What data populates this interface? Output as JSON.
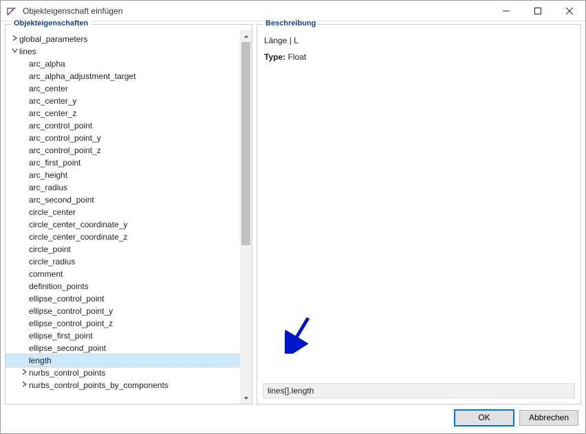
{
  "window": {
    "title": "Objekteigenschaft einfügen"
  },
  "left_panel": {
    "title": "Objekteigenschaften",
    "scroll": {
      "thumb_top_pct": 0,
      "thumb_height_pct": 58
    }
  },
  "right_panel": {
    "title": "Beschreibung",
    "desc_line": "Länge | L",
    "type_label": "Type:",
    "type_value": "Float",
    "path_value": "lines[].length"
  },
  "buttons": {
    "ok": "OK",
    "cancel": "Abbrechen"
  },
  "tree": [
    {
      "label": "global_parameters",
      "depth": 0,
      "expander": ">",
      "selected": false
    },
    {
      "label": "lines",
      "depth": 0,
      "expander": "v",
      "selected": false
    },
    {
      "label": "arc_alpha",
      "depth": 1,
      "expander": "",
      "selected": false
    },
    {
      "label": "arc_alpha_adjustment_target",
      "depth": 1,
      "expander": "",
      "selected": false
    },
    {
      "label": "arc_center",
      "depth": 1,
      "expander": "",
      "selected": false
    },
    {
      "label": "arc_center_y",
      "depth": 1,
      "expander": "",
      "selected": false
    },
    {
      "label": "arc_center_z",
      "depth": 1,
      "expander": "",
      "selected": false
    },
    {
      "label": "arc_control_point",
      "depth": 1,
      "expander": "",
      "selected": false
    },
    {
      "label": "arc_control_point_y",
      "depth": 1,
      "expander": "",
      "selected": false
    },
    {
      "label": "arc_control_point_z",
      "depth": 1,
      "expander": "",
      "selected": false
    },
    {
      "label": "arc_first_point",
      "depth": 1,
      "expander": "",
      "selected": false
    },
    {
      "label": "arc_height",
      "depth": 1,
      "expander": "",
      "selected": false
    },
    {
      "label": "arc_radius",
      "depth": 1,
      "expander": "",
      "selected": false
    },
    {
      "label": "arc_second_point",
      "depth": 1,
      "expander": "",
      "selected": false
    },
    {
      "label": "circle_center",
      "depth": 1,
      "expander": "",
      "selected": false
    },
    {
      "label": "circle_center_coordinate_y",
      "depth": 1,
      "expander": "",
      "selected": false
    },
    {
      "label": "circle_center_coordinate_z",
      "depth": 1,
      "expander": "",
      "selected": false
    },
    {
      "label": "circle_point",
      "depth": 1,
      "expander": "",
      "selected": false
    },
    {
      "label": "circle_radius",
      "depth": 1,
      "expander": "",
      "selected": false
    },
    {
      "label": "comment",
      "depth": 1,
      "expander": "",
      "selected": false
    },
    {
      "label": "definition_points",
      "depth": 1,
      "expander": "",
      "selected": false
    },
    {
      "label": "ellipse_control_point",
      "depth": 1,
      "expander": "",
      "selected": false
    },
    {
      "label": "ellipse_control_point_y",
      "depth": 1,
      "expander": "",
      "selected": false
    },
    {
      "label": "ellipse_control_point_z",
      "depth": 1,
      "expander": "",
      "selected": false
    },
    {
      "label": "ellipse_first_point",
      "depth": 1,
      "expander": "",
      "selected": false
    },
    {
      "label": "ellipse_second_point",
      "depth": 1,
      "expander": "",
      "selected": false
    },
    {
      "label": "length",
      "depth": 1,
      "expander": "",
      "selected": true
    },
    {
      "label": "nurbs_control_points",
      "depth": 1,
      "expander": ">",
      "selected": false
    },
    {
      "label": "nurbs_control_points_by_components",
      "depth": 1,
      "expander": ">",
      "selected": false
    }
  ]
}
